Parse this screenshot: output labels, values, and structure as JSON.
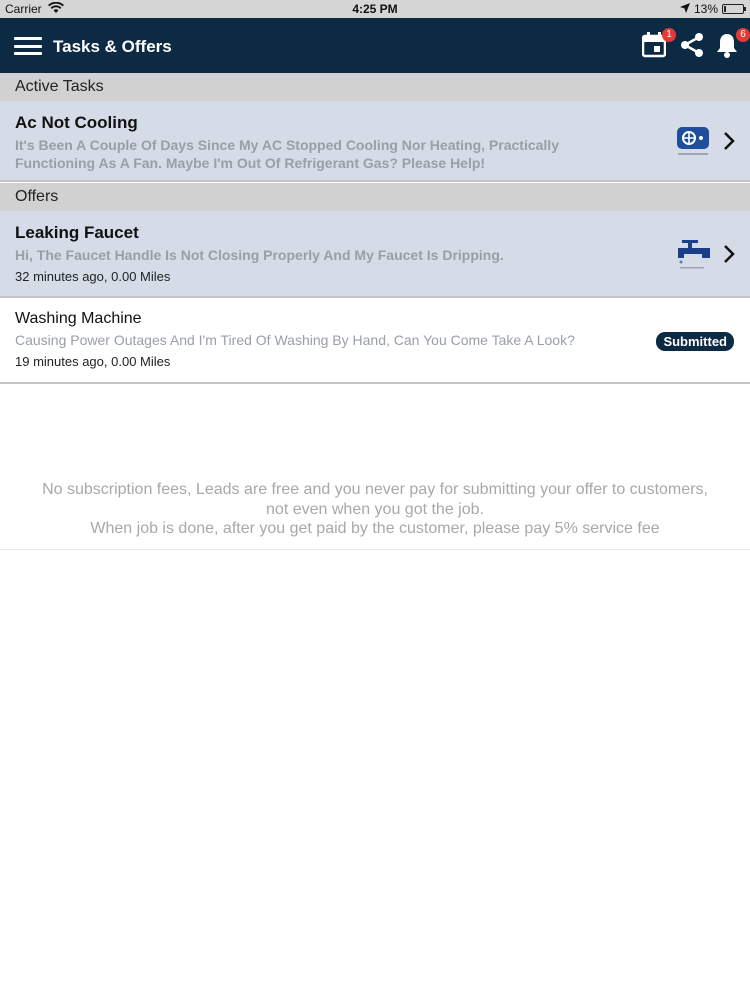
{
  "status_bar": {
    "carrier": "Carrier",
    "time": "4:25 PM",
    "battery": "13%",
    "battery_level": 0.13
  },
  "nav": {
    "title": "Tasks & Offers",
    "calendar_badge": "1",
    "notifications_badge": "6",
    "bar_color": "#0d2a45",
    "badge_color": "#e53935"
  },
  "sections": {
    "active_label": "Active Tasks",
    "offers_label": "Offers"
  },
  "active_tasks": [
    {
      "title": "Ac Not Cooling",
      "description": "It's Been A Couple Of Days Since My AC Stopped Cooling Nor Heating, Practically Functioning As A Fan. Maybe I'm Out Of Refrigerant Gas? Please Help!",
      "icon": "air-conditioner-icon"
    }
  ],
  "offers": [
    {
      "title": "Leaking Faucet",
      "description": "Hi, The Faucet Handle Is Not Closing Properly And My Faucet Is Dripping.",
      "meta": "32 minutes ago, 0.00 Miles",
      "icon": "faucet-icon"
    },
    {
      "title": "Washing Machine",
      "description": "Causing Power Outages And I'm Tired Of Washing By Hand, Can You Come Take A Look?",
      "meta": "19 minutes ago, 0.00 Miles",
      "status": "Submitted"
    }
  ],
  "footer": {
    "line1": "No subscription fees, Leads are free and you never pay for submitting your offer to customers,",
    "line2": "not even when you got the job.",
    "line3": "When job is done, after you get paid by the customer, please pay 5% service fee"
  }
}
